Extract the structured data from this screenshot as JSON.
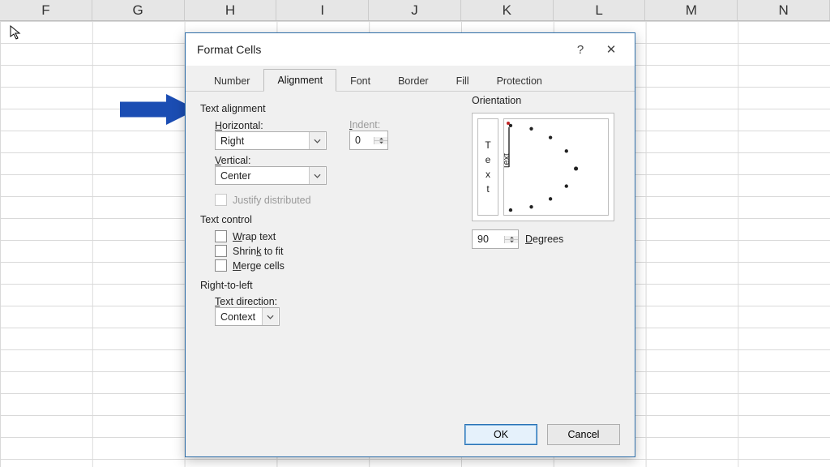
{
  "sheet": {
    "cols": [
      "F",
      "G",
      "H",
      "I",
      "J",
      "K",
      "L",
      "M",
      "N"
    ]
  },
  "dialog": {
    "title": "Format Cells",
    "help": "?",
    "close": "✕",
    "tabs": [
      "Number",
      "Alignment",
      "Font",
      "Border",
      "Fill",
      "Protection"
    ],
    "activeTab": 1
  },
  "alignment": {
    "group": "Text alignment",
    "horizontalLabel": "Horizontal:",
    "horizontalLabel_u": "H",
    "horizontalValue": "Right",
    "verticalLabel": "Vertical:",
    "verticalLabel_u": "V",
    "verticalValue": "Center",
    "indentLabel": "Indent:",
    "indentLabel_u": "I",
    "indentValue": "0",
    "justify": "Justify distributed"
  },
  "textcontrol": {
    "group": "Text control",
    "wrap": "Wrap text",
    "wrap_u": "W",
    "shrink": "Shrink to fit",
    "shrink_u": "k",
    "merge": "Merge cells",
    "merge_u": "M"
  },
  "rtl": {
    "group": "Right-to-left",
    "label": "Text direction:",
    "label_u": "T",
    "value": "Context"
  },
  "orientation": {
    "group": "Orientation",
    "vText": [
      "T",
      "e",
      "x",
      "t"
    ],
    "dialLabel": "Text",
    "degrees": "90",
    "degreesLabel": "Degrees",
    "degreesLabel_u": "D"
  },
  "buttons": {
    "ok": "OK",
    "cancel": "Cancel"
  }
}
